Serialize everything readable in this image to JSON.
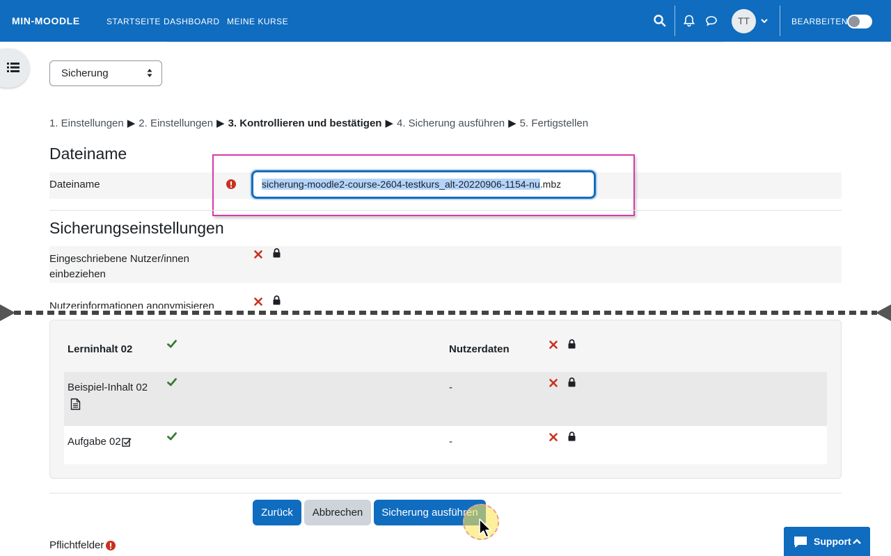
{
  "navbar": {
    "brand": "MIN-MOODLE",
    "links": [
      "STARTSEITE",
      "DASHBOARD",
      "MEINE KURSE"
    ],
    "avatar_initials": "TT",
    "edit_label": "BEARBEITEN"
  },
  "select": {
    "value": "Sicherung"
  },
  "steps": {
    "step1": "1. Einstellungen",
    "step2": "2. Einstellungen",
    "step3": "3. Kontrollieren und bestätigen",
    "step4": "4. Sicherung ausführen",
    "step5": "5. Fertigstellen",
    "arrow": "▶"
  },
  "filename_section": {
    "heading": "Dateiname",
    "label": "Dateiname",
    "value_selected": "sicherung-moodle2-course-2604-testkurs_alt-20220906-1154-nu",
    "value_rest": ".mbz"
  },
  "settings_section": {
    "heading": "Sicherungseinstellungen",
    "row1_label": "Eingeschriebene Nutzer/innen einbeziehen",
    "row2_label": "Nutzerinformationen anonymisieren"
  },
  "table": {
    "header_left": "Lerninhalt 02",
    "header_right": "Nutzerdaten",
    "rows": [
      {
        "name": "Beispiel-Inhalt 02",
        "value": "-"
      },
      {
        "name": "Aufgabe 02",
        "value": "-"
      }
    ]
  },
  "buttons": {
    "back": "Zurück",
    "cancel": "Abbrechen",
    "run": "Sicherung ausführen"
  },
  "required_label": "Pflichtfelder",
  "support_label": "Support",
  "colors": {
    "primary": "#0f6cbf",
    "error": "#ca3120",
    "success": "#357a32"
  }
}
